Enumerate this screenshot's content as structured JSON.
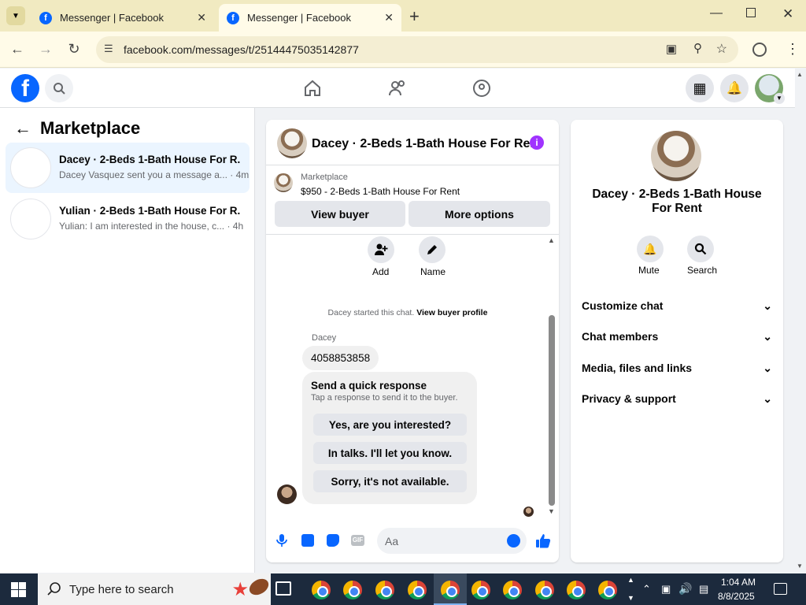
{
  "browser": {
    "tabs": [
      {
        "title": "Messenger | Facebook",
        "active": false
      },
      {
        "title": "Messenger | Facebook",
        "active": true
      }
    ],
    "url": "facebook.com/messages/t/25144475035142877"
  },
  "left": {
    "heading": "Marketplace",
    "conversations": [
      {
        "title": "Dacey · 2-Beds 1-Bath House For R...",
        "preview": "Dacey Vasquez sent you a message a...",
        "time": "· 4m",
        "selected": true
      },
      {
        "title": "Yulian · 2-Beds 1-Bath House For R...",
        "preview": "Yulian: I am interested in the house, c...",
        "time": "· 4h",
        "selected": false
      }
    ]
  },
  "chat": {
    "header_title": "Dacey · 2-Beds 1-Bath House For Re...",
    "listing_source": "Marketplace",
    "listing_title": "$950 - 2-Beds 1-Bath House For Rent",
    "view_buyer": "View buyer",
    "more_options": "More options",
    "add_label": "Add",
    "name_label": "Name",
    "started_text": "Dacey started this chat.",
    "view_profile": "View buyer profile",
    "sender_name": "Dacey",
    "message": "4058853858",
    "quick_title": "Send a quick response",
    "quick_sub": "Tap a response to send it to the buyer.",
    "quick_responses": [
      "Yes, are you interested?",
      "In talks. I'll let you know.",
      "Sorry, it's not available."
    ],
    "composer_placeholder": "Aa"
  },
  "right": {
    "title": "Dacey · 2-Beds 1-Bath House For Rent",
    "mute": "Mute",
    "search": "Search",
    "sections": [
      "Customize chat",
      "Chat members",
      "Media, files and links",
      "Privacy & support"
    ]
  },
  "taskbar": {
    "search_placeholder": "Type here to search",
    "time": "1:04 AM",
    "date": "8/8/2025"
  },
  "colors": {
    "accent": "#0866ff",
    "info": "#a033ff",
    "selected": "#ebf5ff"
  }
}
